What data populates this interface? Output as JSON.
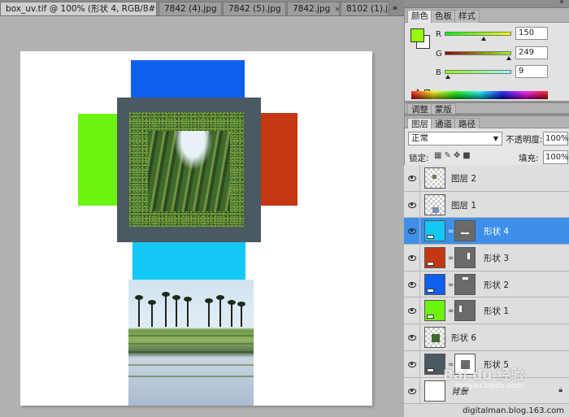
{
  "document_tabs": [
    {
      "label": "box_uv.tif @ 100% (形状 4, RGB/8#) *",
      "active": true
    },
    {
      "label": "7842 (4).jpg",
      "active": false
    },
    {
      "label": "7842 (5).jpg",
      "active": false
    },
    {
      "label": "7842.jpg",
      "active": false
    },
    {
      "label": "8102 (1).j",
      "active": false
    }
  ],
  "tab_close_glyph": "×",
  "tab_scroll_glyph": "»",
  "color_panel": {
    "tabs": [
      "颜色",
      "色板",
      "样式"
    ],
    "foreground": "#96f909",
    "background": "#ffffff",
    "channels": [
      {
        "label": "R",
        "value": "150",
        "fraction": 0.588
      },
      {
        "label": "G",
        "value": "249",
        "fraction": 0.976
      },
      {
        "label": "B",
        "value": "9",
        "fraction": 0.035
      }
    ]
  },
  "adjust_tabs": [
    "调整",
    "蒙版"
  ],
  "layers_panel": {
    "tabs": [
      "图层",
      "通道",
      "路径"
    ],
    "blend_mode": "正常",
    "opacity_label": "不透明度:",
    "opacity_value": "100%",
    "lock_label": "锁定:",
    "fill_label": "填充:",
    "fill_value": "100%",
    "layers": [
      {
        "name": "图层 2",
        "type": "pixel",
        "selected": false,
        "color": "#6b7d55"
      },
      {
        "name": "图层 1",
        "type": "pixel",
        "selected": false,
        "color": "#7b8fb0"
      },
      {
        "name": "形状 4",
        "type": "shape",
        "selected": true,
        "color": "#12c8f6"
      },
      {
        "name": "形状 3",
        "type": "shape",
        "selected": false,
        "color": "#c33812"
      },
      {
        "name": "形状 2",
        "type": "shape",
        "selected": false,
        "color": "#0f5fef"
      },
      {
        "name": "形状 1",
        "type": "shape",
        "selected": false,
        "color": "#6cf40e"
      },
      {
        "name": "形状 6",
        "type": "pixel",
        "selected": false,
        "color": "#3d6b2b"
      },
      {
        "name": "形状 5",
        "type": "shape",
        "selected": false,
        "color": "#4b5960"
      },
      {
        "name": "背景",
        "type": "background",
        "selected": false,
        "color": "#ffffff"
      }
    ]
  },
  "canvas_colors": {
    "top": "#0f5fef",
    "left": "#6cf40e",
    "right": "#c33812",
    "bottom": "#12c8f6",
    "frame": "#4b5960"
  },
  "watermark": {
    "brand": "Bai du 经验",
    "sub": "jingyan.baidu.com",
    "footer": "digitalman.blog.163.com"
  }
}
